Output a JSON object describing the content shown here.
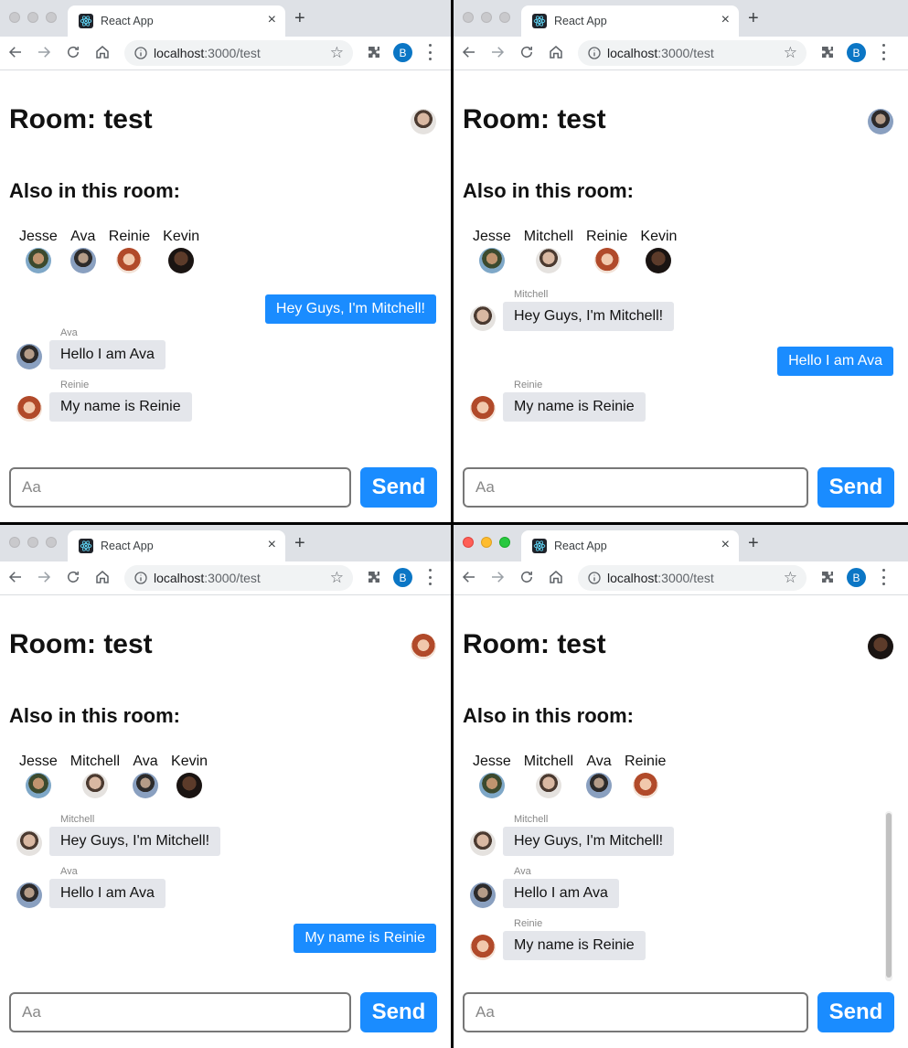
{
  "browser": {
    "tab_title": "React App",
    "url_host": "localhost",
    "url_rest": ":3000/test",
    "profile_initial": "B"
  },
  "colors": {
    "accent": "#1a8cff",
    "bubble_other": "#e4e6eb"
  },
  "icons": [
    "react-logo-icon",
    "close-icon",
    "plus-icon",
    "back-icon",
    "forward-icon",
    "reload-icon",
    "home-icon",
    "info-icon",
    "star-icon",
    "puzzle-icon",
    "menu-icon"
  ],
  "room": {
    "title": "Room: test",
    "also_title": "Also in this room:",
    "input_placeholder": "Aa",
    "send_label": "Send"
  },
  "windows": [
    {
      "self": "Mitchell",
      "members": [
        "Jesse",
        "Ava",
        "Reinie",
        "Kevin"
      ],
      "messages": [
        {
          "sender": "Mitchell",
          "text": "Hey Guys, I'm Mitchell!",
          "own": true
        },
        {
          "sender": "Ava",
          "text": "Hello I am Ava",
          "own": false
        },
        {
          "sender": "Reinie",
          "text": "My name is Reinie",
          "own": false
        }
      ]
    },
    {
      "self": "Ava",
      "members": [
        "Jesse",
        "Mitchell",
        "Reinie",
        "Kevin"
      ],
      "messages": [
        {
          "sender": "Mitchell",
          "text": "Hey Guys, I'm Mitchell!",
          "own": false
        },
        {
          "sender": "Ava",
          "text": "Hello I am Ava",
          "own": true
        },
        {
          "sender": "Reinie",
          "text": "My name is Reinie",
          "own": false
        }
      ]
    },
    {
      "self": "Reinie",
      "members": [
        "Jesse",
        "Mitchell",
        "Ava",
        "Kevin"
      ],
      "messages": [
        {
          "sender": "Mitchell",
          "text": "Hey Guys, I'm Mitchell!",
          "own": false
        },
        {
          "sender": "Ava",
          "text": "Hello I am Ava",
          "own": false
        },
        {
          "sender": "Reinie",
          "text": "My name is Reinie",
          "own": true
        }
      ]
    },
    {
      "self": "Kevin",
      "members": [
        "Jesse",
        "Mitchell",
        "Ava",
        "Reinie"
      ],
      "messages": [
        {
          "sender": "Mitchell",
          "text": "Hey Guys, I'm Mitchell!",
          "own": false
        },
        {
          "sender": "Ava",
          "text": "Hello I am Ava",
          "own": false
        },
        {
          "sender": "Reinie",
          "text": "My name is Reinie",
          "own": false
        }
      ]
    }
  ]
}
